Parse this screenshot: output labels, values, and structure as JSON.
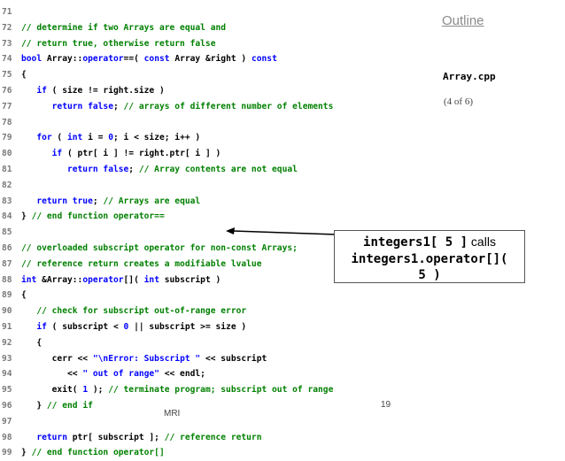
{
  "title": "Outline",
  "file": "Array.cpp",
  "page": "(4 of 6)",
  "slide_number": "19",
  "footer": "MRI",
  "callout": {
    "line1_code": "integers1[ 5 ]",
    "line1_text": " calls",
    "line2_code": "integers1.operator[](",
    "line3_code": "5 )"
  },
  "code": [
    {
      "n": "71",
      "parts": []
    },
    {
      "n": "72",
      "parts": [
        [
          "cm",
          "// determine if two Arrays are equal and"
        ]
      ]
    },
    {
      "n": "73",
      "parts": [
        [
          "cm",
          "// return true, otherwise return false"
        ]
      ]
    },
    {
      "n": "74",
      "parts": [
        [
          "kw",
          "bool"
        ],
        [
          "tx",
          " Array::"
        ],
        [
          "kw",
          "operator"
        ],
        [
          "tx",
          "==( "
        ],
        [
          "kw",
          "const"
        ],
        [
          "tx",
          " Array &right ) "
        ],
        [
          "kw",
          "const"
        ]
      ]
    },
    {
      "n": "75",
      "parts": [
        [
          "tx",
          "{"
        ]
      ]
    },
    {
      "n": "76",
      "parts": [
        [
          "tx",
          "   "
        ],
        [
          "kw",
          "if"
        ],
        [
          "tx",
          " ( size != right.size )"
        ]
      ]
    },
    {
      "n": "77",
      "parts": [
        [
          "tx",
          "      "
        ],
        [
          "kw",
          "return false"
        ],
        [
          "tx",
          "; "
        ],
        [
          "cm",
          "// arrays of different number of elements"
        ]
      ]
    },
    {
      "n": "78",
      "parts": []
    },
    {
      "n": "79",
      "parts": [
        [
          "tx",
          "   "
        ],
        [
          "kw",
          "for"
        ],
        [
          "tx",
          " ( "
        ],
        [
          "kw",
          "int"
        ],
        [
          "tx",
          " i = "
        ],
        [
          "kw",
          "0"
        ],
        [
          "tx",
          "; i < size; i++ )"
        ]
      ]
    },
    {
      "n": "80",
      "parts": [
        [
          "tx",
          "      "
        ],
        [
          "kw",
          "if"
        ],
        [
          "tx",
          " ( ptr[ i ] != right.ptr[ i ] )"
        ]
      ]
    },
    {
      "n": "81",
      "parts": [
        [
          "tx",
          "         "
        ],
        [
          "kw",
          "return false"
        ],
        [
          "tx",
          "; "
        ],
        [
          "cm",
          "// Array contents are not equal"
        ]
      ]
    },
    {
      "n": "82",
      "parts": []
    },
    {
      "n": "83",
      "parts": [
        [
          "tx",
          "   "
        ],
        [
          "kw",
          "return true"
        ],
        [
          "tx",
          "; "
        ],
        [
          "cm",
          "// Arrays are equal"
        ]
      ]
    },
    {
      "n": "84",
      "parts": [
        [
          "tx",
          "} "
        ],
        [
          "cm",
          "// end function operator=="
        ]
      ]
    },
    {
      "n": "85",
      "parts": []
    },
    {
      "n": "86",
      "parts": [
        [
          "cm",
          "// overloaded subscript operator for non-const Arrays;"
        ]
      ]
    },
    {
      "n": "87",
      "parts": [
        [
          "cm",
          "// reference return creates a modifiable lvalue"
        ]
      ]
    },
    {
      "n": "88",
      "parts": [
        [
          "kw",
          "int"
        ],
        [
          "tx",
          " &Array::"
        ],
        [
          "kw",
          "operator"
        ],
        [
          "tx",
          "[]( "
        ],
        [
          "kw",
          "int"
        ],
        [
          "tx",
          " subscript )"
        ]
      ]
    },
    {
      "n": "89",
      "parts": [
        [
          "tx",
          "{"
        ]
      ]
    },
    {
      "n": "90",
      "parts": [
        [
          "tx",
          "   "
        ],
        [
          "cm",
          "// check for subscript out-of-range error"
        ]
      ]
    },
    {
      "n": "91",
      "parts": [
        [
          "tx",
          "   "
        ],
        [
          "kw",
          "if"
        ],
        [
          "tx",
          " ( subscript < "
        ],
        [
          "kw",
          "0"
        ],
        [
          "tx",
          " || subscript >= size )"
        ]
      ]
    },
    {
      "n": "92",
      "parts": [
        [
          "tx",
          "   {"
        ]
      ]
    },
    {
      "n": "93",
      "parts": [
        [
          "tx",
          "      cerr << "
        ],
        [
          "str",
          "\"\\nError: Subscript \""
        ],
        [
          "tx",
          " << subscript"
        ]
      ]
    },
    {
      "n": "94",
      "parts": [
        [
          "tx",
          "         << "
        ],
        [
          "str",
          "\" out of range\""
        ],
        [
          "tx",
          " << endl;"
        ]
      ]
    },
    {
      "n": "95",
      "parts": [
        [
          "tx",
          "      exit( "
        ],
        [
          "kw",
          "1"
        ],
        [
          "tx",
          " ); "
        ],
        [
          "cm",
          "// terminate program; subscript out of range"
        ]
      ]
    },
    {
      "n": "96",
      "parts": [
        [
          "tx",
          "   } "
        ],
        [
          "cm",
          "// end if"
        ]
      ]
    },
    {
      "n": "97",
      "parts": []
    },
    {
      "n": "98",
      "parts": [
        [
          "tx",
          "   "
        ],
        [
          "kw",
          "return"
        ],
        [
          "tx",
          " ptr[ subscript ]; "
        ],
        [
          "cm",
          "// reference return"
        ]
      ]
    },
    {
      "n": "99",
      "parts": [
        [
          "tx",
          "} "
        ],
        [
          "cm",
          "// end function operator[]"
        ]
      ]
    }
  ]
}
